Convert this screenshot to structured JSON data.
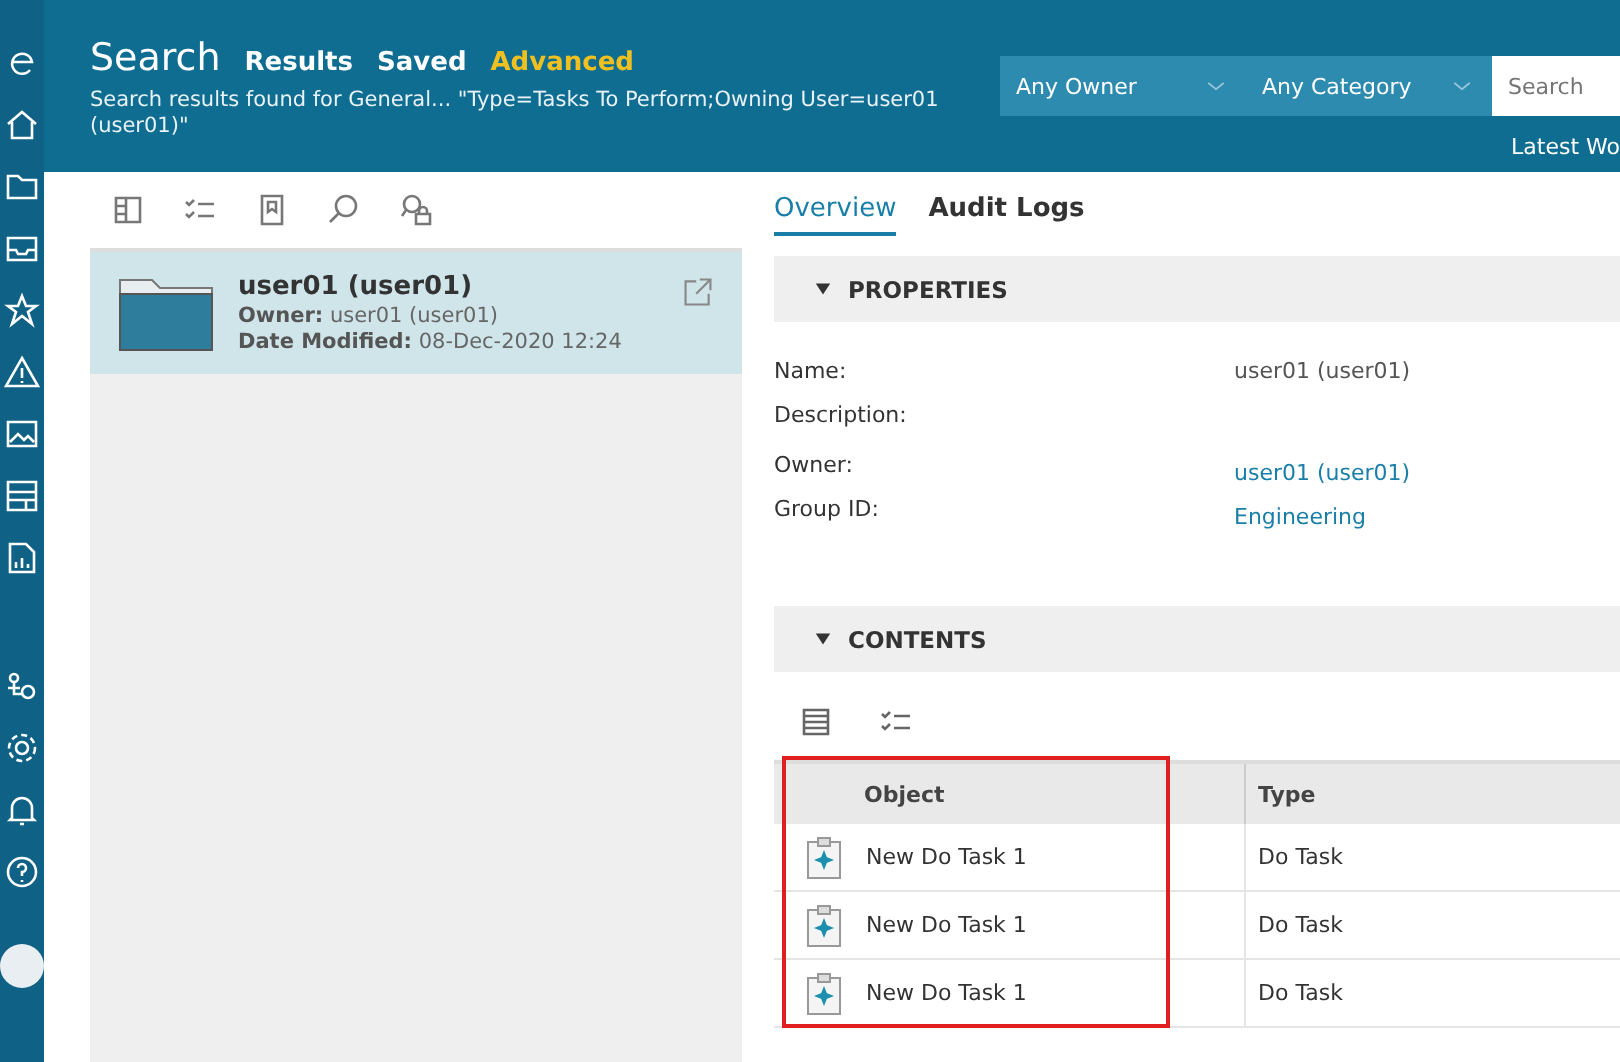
{
  "header": {
    "title": "Search",
    "tabs": [
      {
        "label": "Results",
        "selected": false
      },
      {
        "label": "Saved",
        "selected": false
      },
      {
        "label": "Advanced",
        "selected": true
      }
    ],
    "subtitle": "Search results found for General... \"Type=Tasks To Perform;Owning User=user01 (user01)\"",
    "filters": [
      {
        "label": "Any Owner"
      },
      {
        "label": "Any Category"
      }
    ],
    "search": {
      "placeholder": "Search"
    },
    "link": "Latest Wo"
  },
  "results": [
    {
      "title": "user01 (user01)",
      "owner_label": "Owner:",
      "owner": "user01 (user01)",
      "date_label": "Date Modified:",
      "date": "08-Dec-2020 12:24",
      "selected": true
    }
  ],
  "detail_tabs": [
    {
      "label": "Overview",
      "selected": true
    },
    {
      "label": "Audit Logs",
      "selected": false
    }
  ],
  "properties": {
    "title": "PROPERTIES",
    "expanded": true,
    "rows": [
      {
        "label": "Name:",
        "value": "user01 (user01)",
        "kind": "text"
      },
      {
        "label": "Description:",
        "kind": "text"
      },
      {
        "label": "Owner:",
        "value": "user01 (user01)",
        "kind": "link"
      },
      {
        "label": "Group ID:",
        "value": "Engineering",
        "kind": "link"
      }
    ]
  },
  "contents": {
    "title": "CONTENTS",
    "expanded": true,
    "columns": [
      "Object",
      "Type"
    ],
    "rows": [
      {
        "object": "New Do Task 1",
        "type": "Do Task"
      },
      {
        "object": "New Do Task 1",
        "type": "Do Task"
      },
      {
        "object": "New Do Task 1",
        "type": "Do Task"
      }
    ]
  }
}
